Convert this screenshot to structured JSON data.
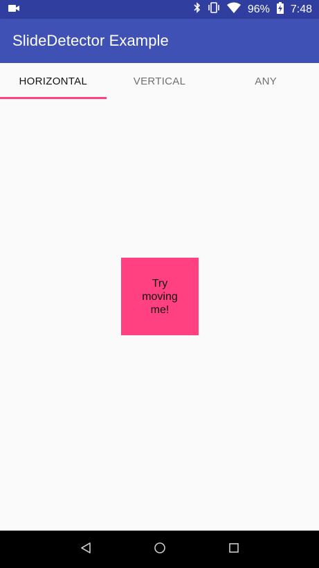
{
  "status_bar": {
    "battery_percent": "96%",
    "time": "7:48",
    "icons": [
      "video-camera-icon",
      "bluetooth-icon",
      "vibrate-icon",
      "wifi-icon",
      "battery-charging-icon"
    ]
  },
  "app_bar": {
    "title": "SlideDetector Example"
  },
  "tabs": [
    {
      "label": "HORIZONTAL",
      "selected": true
    },
    {
      "label": "VERTICAL",
      "selected": false
    },
    {
      "label": "ANY",
      "selected": false
    }
  ],
  "draggable_box": {
    "label": "Try moving me!",
    "color": "#ff4081"
  },
  "nav_bar": {
    "buttons": [
      "back-icon",
      "home-icon",
      "recents-icon"
    ]
  },
  "colors": {
    "primary": "#3f51b5",
    "primary_dark": "#303f9f",
    "accent": "#ff4081",
    "background": "#fafafa"
  }
}
